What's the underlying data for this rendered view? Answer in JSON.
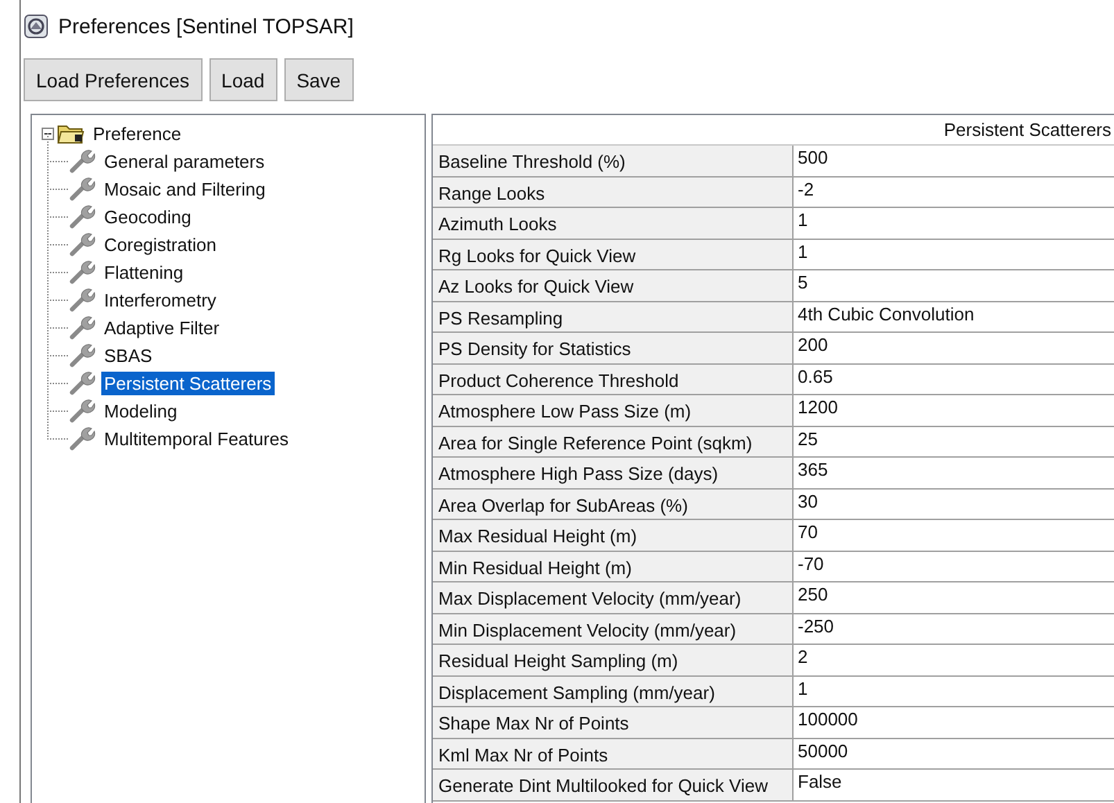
{
  "window": {
    "title": "Preferences [Sentinel TOPSAR]"
  },
  "toolbar": {
    "buttons": [
      "Load Preferences",
      "Load",
      "Save"
    ]
  },
  "tree": {
    "label": "Preference",
    "expanded": true,
    "selected": false,
    "children": [
      {
        "label": "General parameters",
        "selected": false
      },
      {
        "label": "Mosaic and Filtering",
        "selected": false
      },
      {
        "label": "Geocoding",
        "selected": false
      },
      {
        "label": "Coregistration",
        "selected": false
      },
      {
        "label": "Flattening",
        "selected": false
      },
      {
        "label": "Interferometry",
        "selected": false
      },
      {
        "label": "Adaptive Filter",
        "selected": false
      },
      {
        "label": "SBAS",
        "selected": false
      },
      {
        "label": "Persistent Scatterers",
        "selected": true
      },
      {
        "label": "Modeling",
        "selected": false
      },
      {
        "label": "Multitemporal Features",
        "selected": false
      }
    ]
  },
  "table": {
    "column_header": "Persistent Scatterers",
    "rows": [
      {
        "name": "Baseline Threshold (%)",
        "value": "500"
      },
      {
        "name": "Range Looks",
        "value": "-2"
      },
      {
        "name": "Azimuth Looks",
        "value": "1"
      },
      {
        "name": "Rg Looks for Quick View",
        "value": "1"
      },
      {
        "name": "Az Looks for Quick View",
        "value": "5"
      },
      {
        "name": "PS Resampling",
        "value": "4th Cubic Convolution"
      },
      {
        "name": "PS Density for Statistics",
        "value": "200"
      },
      {
        "name": "Product Coherence Threshold",
        "value": "0.65"
      },
      {
        "name": "Atmosphere Low Pass Size (m)",
        "value": "1200"
      },
      {
        "name": "Area for Single Reference Point (sqkm)",
        "value": "25"
      },
      {
        "name": "Atmosphere High Pass Size (days)",
        "value": "365"
      },
      {
        "name": "Area Overlap for SubAreas (%)",
        "value": "30"
      },
      {
        "name": "Max Residual Height (m)",
        "value": "70"
      },
      {
        "name": "Min Residual Height (m)",
        "value": "-70"
      },
      {
        "name": "Max Displacement Velocity (mm/year)",
        "value": "250"
      },
      {
        "name": "Min Displacement Velocity (mm/year)",
        "value": "-250"
      },
      {
        "name": "Residual Height Sampling (m)",
        "value": "2"
      },
      {
        "name": "Displacement Sampling (mm/year)",
        "value": "1"
      },
      {
        "name": "Shape Max Nr of Points",
        "value": "100000"
      },
      {
        "name": "Kml Max Nr of Points",
        "value": "50000"
      },
      {
        "name": "Generate Dint Multilooked for Quick View",
        "value": "False"
      }
    ]
  }
}
